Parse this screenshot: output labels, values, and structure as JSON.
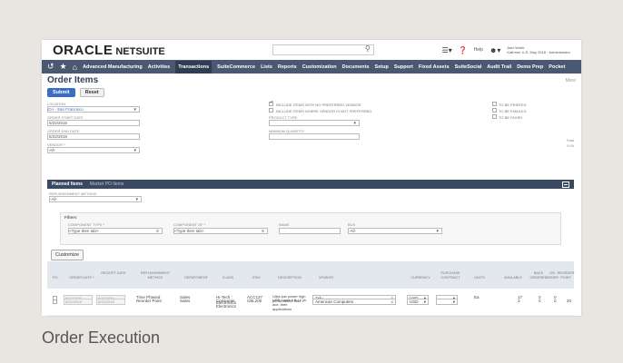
{
  "header": {
    "logo_brand": "ORACLE",
    "logo_product": "NETSUITE",
    "search_icon": "search-icon",
    "help_label": "Help",
    "user_name": "Alex Wolfe",
    "user_company": "Kathmer U.S. May 2016 · Administrator"
  },
  "nav": {
    "items": [
      {
        "label": "Advanced Manufacturing",
        "active": false
      },
      {
        "label": "Activities",
        "active": false
      },
      {
        "label": "Transactions",
        "active": true
      },
      {
        "label": "SuiteCommerce",
        "active": false
      },
      {
        "label": "Lists",
        "active": false
      },
      {
        "label": "Reports",
        "active": false
      },
      {
        "label": "Customization",
        "active": false
      },
      {
        "label": "Documents",
        "active": false
      },
      {
        "label": "Setup",
        "active": false
      },
      {
        "label": "Support",
        "active": false
      },
      {
        "label": "Fixed Assets",
        "active": false
      },
      {
        "label": "SuiteSocial",
        "active": false
      },
      {
        "label": "Audit Trail",
        "active": false
      },
      {
        "label": "Demo Prep",
        "active": false
      },
      {
        "label": "Pocket",
        "active": false
      }
    ]
  },
  "page": {
    "title": "Order Items",
    "more": "More",
    "submit": "Submit",
    "reset": "Reset"
  },
  "form": {
    "location_label": "Location",
    "location_value": "CA - San Francisco",
    "order_start_label": "Order Start Date",
    "order_start_value": "6/22/2016",
    "order_end_label": "Order End Date",
    "order_end_value": "6/22/2016",
    "vendor_label": "Vendor *",
    "vendor_value": "-All-",
    "check_preferred": "Include Items with No Preferred Vendor",
    "check_not_preferred": "Include Items Where Vendor Is Not Preferred",
    "product_type_label": "Product Type",
    "min_quantity_label": "Minimum Quantity",
    "to_be_printed": "To Be Printed",
    "to_be_emailed": "To Be Emailed",
    "to_be_faxed": "To Be Faxed",
    "total_label": "Total",
    "total_value": "0.00"
  },
  "subtabs": {
    "planned": "Planned Items",
    "market": "Market PO Items"
  },
  "lower": {
    "replenishment_label": "Replenishment Method",
    "replenishment_value": "-All-",
    "filters_title": "Filters",
    "component_type_label": "Component Type *",
    "component_type_value": "<Type then tab>",
    "component_of_label": "Component Of *",
    "component_of_value": "<Type then tab>",
    "name_label": "Name",
    "bus_label": "Bus",
    "bus_value": "-All-",
    "customize": "Customize"
  },
  "table": {
    "headers": [
      "PO",
      "Order Date *",
      "Receipt Date",
      "Replenishment Method",
      "Department",
      "Class",
      "Item",
      "Description",
      "Vendor",
      "Currency",
      "Purchase Contract",
      "Units",
      "Available",
      "Back Ordered",
      "On Order",
      "Reorder Point"
    ],
    "rows": [
      {
        "order_date": "6/11/2016",
        "receipt_date": "6/11/2016",
        "method": "Time Phased",
        "department": "Sales",
        "class": "Hi-Tech : Electronics",
        "item": "ACC127",
        "description": "Ultra-low power high performance fiber-ace, their applications",
        "vendor": "Zulu",
        "currency": "USD",
        "units": "Ea",
        "available": "17",
        "back_ordered": "0",
        "on_order": "0",
        "reorder": ""
      },
      {
        "order_date": "6/22/2016",
        "receipt_date": "6/22/2016",
        "method": "Reorder Point",
        "department": "Sales",
        "class": "Consumer Electronics",
        "item": "CBL200",
        "description": "USB Cable 6 ft / 2 pk",
        "vendor": "American Computers",
        "currency": "USD",
        "units": "",
        "available": "3",
        "back_ordered": "0",
        "on_order": "0",
        "reorder": "20"
      }
    ]
  },
  "caption": "Order Execution"
}
